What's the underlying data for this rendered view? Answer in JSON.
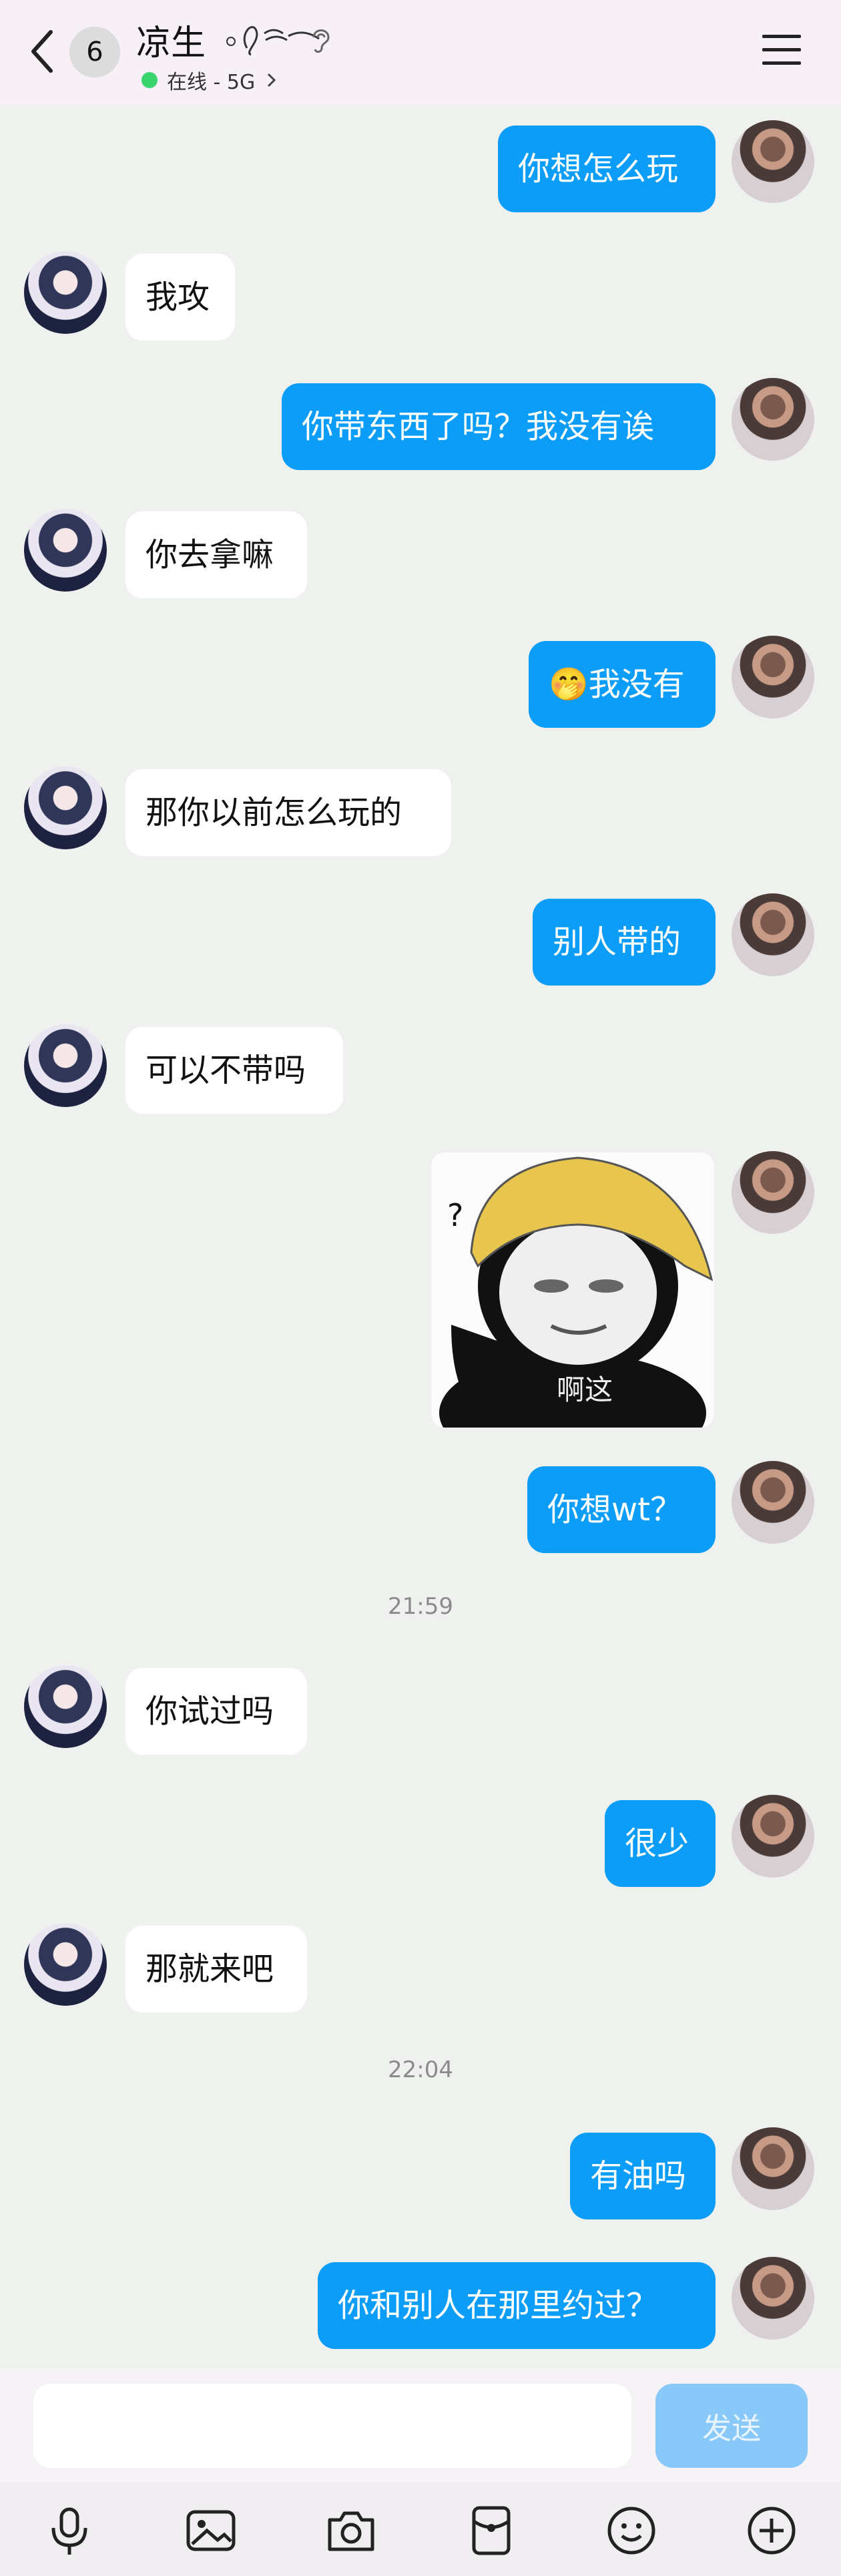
{
  "header": {
    "unread_count": "6",
    "contact_name": "凉生",
    "status_text": "在线 - 5G",
    "colors": {
      "online": "#3ad46f",
      "header_bg": "#f7f1f7"
    }
  },
  "messages": [
    {
      "side": "out",
      "text": "你想怎么玩"
    },
    {
      "side": "in",
      "text": "我攻"
    },
    {
      "side": "out",
      "text": "你带东西了吗？我没有诶"
    },
    {
      "side": "in",
      "text": "你去拿嘛"
    },
    {
      "side": "out",
      "text": "我没有",
      "emoji": "🤭"
    },
    {
      "side": "in",
      "text": "那你以前怎么玩的"
    },
    {
      "side": "out",
      "text": "别人带的"
    },
    {
      "side": "in",
      "text": "可以不带吗"
    },
    {
      "side": "out",
      "sticker_caption": "啊这",
      "sticker_mark": "?"
    },
    {
      "side": "out",
      "text": "你想wt？"
    },
    {
      "time": "21:59"
    },
    {
      "side": "in",
      "text": "你试过吗"
    },
    {
      "side": "out",
      "text": "很少"
    },
    {
      "side": "in",
      "text": "那就来吧"
    },
    {
      "time": "22:04"
    },
    {
      "side": "out",
      "text": "有油吗"
    },
    {
      "side": "out",
      "text": "你和别人在那里约过？"
    }
  ],
  "composer": {
    "placeholder": "",
    "send_label": "发送",
    "colors": {
      "send_disabled": "#89c9fa",
      "bubble_out": "#0c9df9"
    }
  },
  "toolbar_icons": [
    "microphone-icon",
    "image-icon",
    "camera-icon",
    "red-packet-icon",
    "emoji-icon",
    "plus-icon"
  ]
}
